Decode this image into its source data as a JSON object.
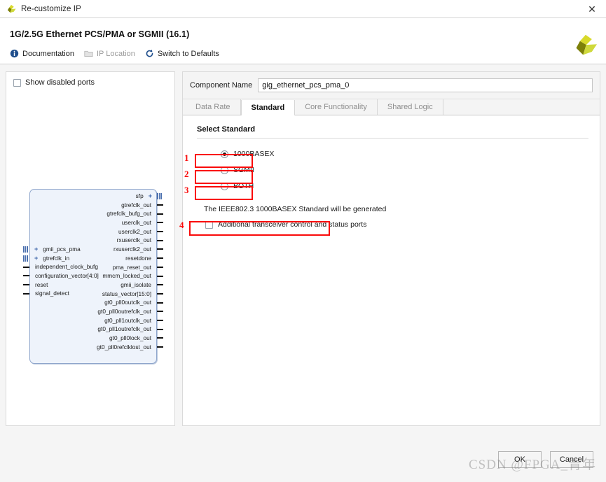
{
  "window": {
    "title": "Re-customize IP",
    "close_label": "✕",
    "logo_icon": "xilinx-logo-icon"
  },
  "header": {
    "ip_title": "1G/2.5G Ethernet PCS/PMA or SGMII (16.1)",
    "toolbar": [
      {
        "label": "Documentation",
        "icon": "info-icon",
        "disabled": false
      },
      {
        "label": "IP Location",
        "icon": "folder-icon",
        "disabled": true
      },
      {
        "label": "Switch to Defaults",
        "icon": "refresh-icon",
        "disabled": false
      }
    ]
  },
  "left_panel": {
    "show_disabled_ports_label": "Show disabled ports",
    "show_disabled_ports_checked": false,
    "ports_left": [
      {
        "name": "gmii_pcs_pma",
        "type": "bus"
      },
      {
        "name": "gtrefclk_in",
        "type": "bus"
      },
      {
        "name": "independent_clock_bufg",
        "type": "pin"
      },
      {
        "name": "configuration_vector[4:0]",
        "type": "pin"
      },
      {
        "name": "reset",
        "type": "pin"
      },
      {
        "name": "signal_detect",
        "type": "pin"
      }
    ],
    "ports_right": [
      {
        "name": "sfp",
        "type": "bus"
      },
      {
        "name": "gtrefclk_out",
        "type": "pin"
      },
      {
        "name": "gtrefclk_bufg_out",
        "type": "pin"
      },
      {
        "name": "userclk_out",
        "type": "pin"
      },
      {
        "name": "userclk2_out",
        "type": "pin"
      },
      {
        "name": "rxuserclk_out",
        "type": "pin"
      },
      {
        "name": "rxuserclk2_out",
        "type": "pin"
      },
      {
        "name": "resetdone",
        "type": "pin"
      },
      {
        "name": "pma_reset_out",
        "type": "pin"
      },
      {
        "name": "mmcm_locked_out",
        "type": "pin"
      },
      {
        "name": "gmii_isolate",
        "type": "pin"
      },
      {
        "name": "status_vector[15:0]",
        "type": "pin"
      },
      {
        "name": "gt0_pll0outclk_out",
        "type": "pin"
      },
      {
        "name": "gt0_pll0outrefclk_out",
        "type": "pin"
      },
      {
        "name": "gt0_pll1outclk_out",
        "type": "pin"
      },
      {
        "name": "gt0_pll1outrefclk_out",
        "type": "pin"
      },
      {
        "name": "gt0_pll0lock_out",
        "type": "pin"
      },
      {
        "name": "gt0_pll0refclklost_out",
        "type": "pin"
      }
    ]
  },
  "right_panel": {
    "component_name_label": "Component Name",
    "component_name_value": "gig_ethernet_pcs_pma_0",
    "tabs": [
      {
        "label": "Data Rate",
        "active": false
      },
      {
        "label": "Standard",
        "active": true
      },
      {
        "label": "Core Functionality",
        "active": false
      },
      {
        "label": "Shared Logic",
        "active": false
      }
    ],
    "section_title": "Select Standard",
    "standard_options": [
      {
        "label": "1000BASEX",
        "selected": true
      },
      {
        "label": "SGMII",
        "selected": false
      },
      {
        "label": "BOTH",
        "selected": false
      }
    ],
    "note_text": "The IEEE802.3 1000BASEX Standard will be generated",
    "additional_ports_label": "Additional transceiver control and status ports",
    "additional_ports_checked": false
  },
  "annotations": {
    "color": "#fa0a0a",
    "markers": [
      "1",
      "2",
      "3",
      "4"
    ]
  },
  "footer": {
    "ok_label": "OK",
    "cancel_label": "Cancel",
    "watermark": "CSDN @FPGA_青年"
  }
}
